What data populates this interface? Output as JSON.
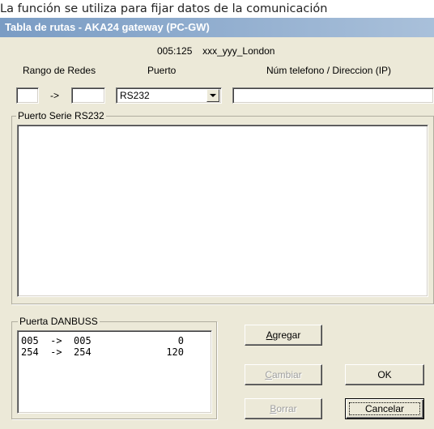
{
  "caption": "La función se utiliza para fijar datos de la comunicación",
  "window": {
    "title": "Tabla de rutas - AKA24 gateway  (PC-GW)"
  },
  "header": {
    "node_address": "005:125",
    "node_name": "xxx_yyy_London"
  },
  "columns": {
    "range_label": "Rango de Redes",
    "port_label": "Puerto",
    "phone_label": "Núm telefono / Direccion (IP)"
  },
  "form": {
    "range_from": "",
    "arrow": "->",
    "range_to": "",
    "port_selected": "RS232",
    "phone_value": ""
  },
  "serial_group": {
    "label": "Puerto Serie RS232"
  },
  "danbuss_group": {
    "label": "Puerta DANBUSS",
    "rows": [
      {
        "from": "005",
        "arrow": "->",
        "to": "005",
        "value": "0"
      },
      {
        "from": "254",
        "arrow": "->",
        "to": "254",
        "value": "120"
      }
    ]
  },
  "buttons": {
    "add_mnemonic": "A",
    "add_rest": "gregar",
    "change_mnemonic": "C",
    "change_rest": "ambiar",
    "delete_mnemonic": "B",
    "delete_rest": "orrar",
    "ok": "OK",
    "cancel": "Cancelar"
  },
  "icons": {
    "dropdown": "chevron-down-icon"
  },
  "colors": {
    "title_bar": "#7a9cc4",
    "dialog_bg": "#ece9d8",
    "disabled_text": "#a0a0a0"
  }
}
